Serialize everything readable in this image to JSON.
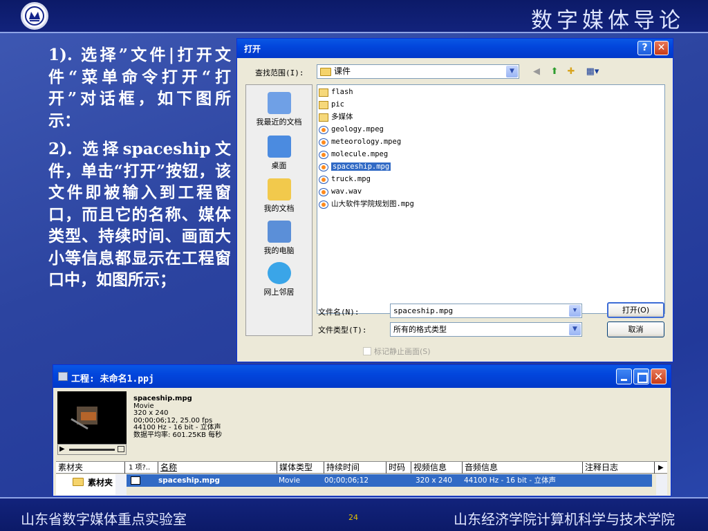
{
  "header": {
    "brand": "数字媒体导论"
  },
  "slide": {
    "paragraph1": "1). 选择”文件|打开文件“菜单命令打开“打开”对话框，如下图所示：",
    "paragraph2": "2). 选择spaceship文件，单击“打开”按钮，该文件即被输入到工程窗口，而且它的名称、媒体类型、持续时间、画面大小等信息都显示在工程窗口中，如图所示；"
  },
  "open_dialog": {
    "title": "打开",
    "help_label": "?",
    "close_label": "✕",
    "look_in_label": "查找范围(I):",
    "look_in_value": "课件",
    "places": [
      {
        "label": "我最近的文档",
        "icon": "recent-documents-icon",
        "color": "#6fa0e6"
      },
      {
        "label": "桌面",
        "icon": "desktop-icon",
        "color": "#4b8be0"
      },
      {
        "label": "我的文档",
        "icon": "my-documents-icon",
        "color": "#f2c94c"
      },
      {
        "label": "我的电脑",
        "icon": "my-computer-icon",
        "color": "#5b8fd8"
      },
      {
        "label": "网上邻居",
        "icon": "network-places-icon",
        "color": "#3aa5e8"
      }
    ],
    "files": [
      {
        "name": "flash",
        "type": "folder"
      },
      {
        "name": "pic",
        "type": "folder"
      },
      {
        "name": "多媒体",
        "type": "folder"
      },
      {
        "name": "geology.mpeg",
        "type": "media"
      },
      {
        "name": "meteorology.mpeg",
        "type": "media"
      },
      {
        "name": "molecule.mpeg",
        "type": "media"
      },
      {
        "name": "spaceship.mpg",
        "type": "media",
        "selected": true
      },
      {
        "name": "truck.mpg",
        "type": "media"
      },
      {
        "name": "wav.wav",
        "type": "media"
      },
      {
        "name": "山大软件学院规划图.mpg",
        "type": "media"
      }
    ],
    "filename_label": "文件名(N):",
    "filename_value": "spaceship.mpg",
    "filetype_label": "文件类型(T):",
    "filetype_value": "所有的格式类型",
    "open_button": "打开(O)",
    "cancel_button": "取消",
    "checkbox_label": "标记静止画面(S)"
  },
  "project_window": {
    "title": "工程: 未命名1.ppj",
    "info": {
      "name": "spaceship.mpg",
      "kind": "Movie",
      "size": "320 x 240",
      "duration": "00;00;06;12, 25.00 fps",
      "audio": "44100 Hz - 16 bit - 立体声",
      "datarate": "数据平均率: 601.25KB 每秒"
    },
    "bin_header": "素材夹",
    "bin_item": "素材夹",
    "count_header": "1 项?..",
    "columns": [
      "名称",
      "媒体类型",
      "持续时间",
      "时码",
      "视频信息",
      "音频信息",
      "注释日志"
    ],
    "row": {
      "name": "spaceship.mpg",
      "media_type": "Movie",
      "duration": "00;00;06;12",
      "video": "320 x 240",
      "audio": "44100 Hz - 16 bit - 立体声"
    }
  },
  "footer": {
    "left": "山东省数字媒体重点实验室",
    "page": "24",
    "right": "山东经济学院计算机科学与技术学院"
  }
}
